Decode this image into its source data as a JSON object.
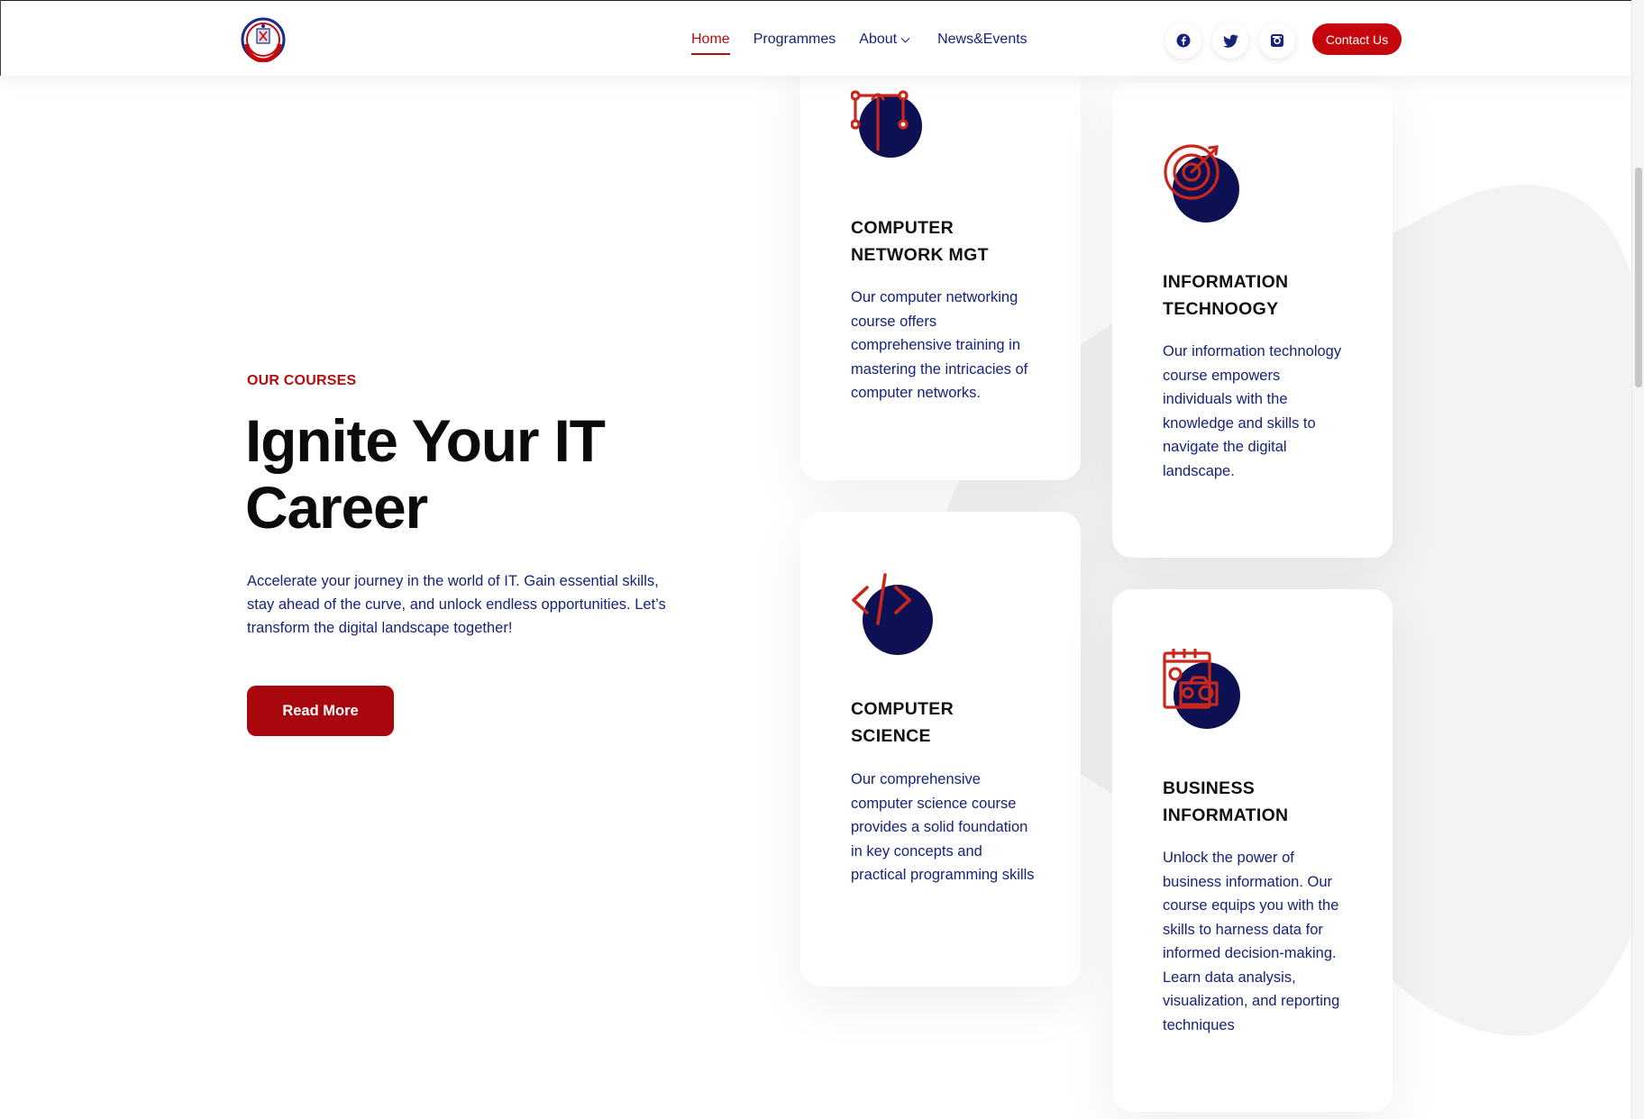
{
  "header": {
    "nav": [
      {
        "label": "Home",
        "active": true
      },
      {
        "label": "Programmes"
      },
      {
        "label": "About"
      },
      {
        "label": "News&Events"
      }
    ],
    "social": [
      "facebook-icon",
      "twitter-icon",
      "instagram-icon"
    ],
    "contact_label": "Contact Us"
  },
  "hero": {
    "eyebrow": "OUR COURSES",
    "title_line1": "Ignite Your IT",
    "title_line2": "Career",
    "description": "Accelerate your journey in the world of IT. Gain essential skills, stay ahead of the curve, and unlock endless opportunities. Let’s transform the digital landscape together!",
    "button_label": "Read More"
  },
  "courses": [
    {
      "icon": "pen-tool-icon",
      "title_line1": "COMPUTER",
      "title_line2": "NETWORK MGT",
      "description": "Our computer networking course offers comprehensive training in mastering the intricacies of computer networks."
    },
    {
      "icon": "target-icon",
      "title_line1": "INFORMATION",
      "title_line2": "TECHNOOGY",
      "description": "Our information technology course empowers individuals with the knowledge and skills to navigate the digital landscape."
    },
    {
      "icon": "code-icon",
      "title_line1": "COMPUTER",
      "title_line2": "SCIENCE",
      "description": "Our comprehensive computer science course provides a solid foundation in key concepts and practical programming skills"
    },
    {
      "icon": "calendar-camera-icon",
      "title_line1": "BUSINESS",
      "title_line2": "INFORMATION",
      "description": "Unlock the power of business information. Our course equips you with the skills to harness data for informed decision-making. Learn data analysis, visualization, and reporting techniques"
    }
  ],
  "colors": {
    "brand_red": "#b50d0d",
    "button_red": "#a8070d",
    "navy": "#17227a",
    "icon_circle": "#0d1154"
  }
}
